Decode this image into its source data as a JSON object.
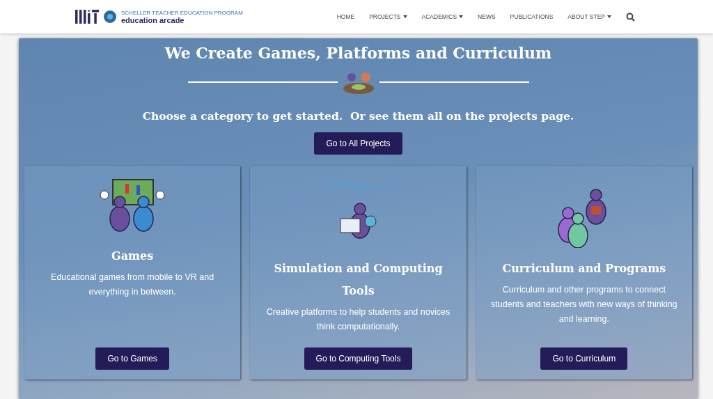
{
  "header": {
    "logo": {
      "program": "SCHELLER TEACHER EDUCATION PROGRAM",
      "name": "education arcade"
    },
    "nav": [
      {
        "label": "HOME",
        "dropdown": false
      },
      {
        "label": "PROJECTS",
        "dropdown": true
      },
      {
        "label": "ACADEMICS",
        "dropdown": true
      },
      {
        "label": "NEWS",
        "dropdown": false
      },
      {
        "label": "PUBLICATIONS",
        "dropdown": false
      },
      {
        "label": "ABOUT STEP",
        "dropdown": true
      }
    ]
  },
  "hero": {
    "title": "We Create Games, Platforms and Curriculum",
    "subtitle": "Choose a category to get started.  Or see them all on the projects page.",
    "button": "Go to All Projects"
  },
  "cards": [
    {
      "kind": "games",
      "title": "Games",
      "description": "Educational games from mobile to VR and everything in between.",
      "button": "Go to Games"
    },
    {
      "kind": "computing",
      "title": "Simulation and Computing Tools",
      "description": "Creative platforms to help students and novices think computationally.",
      "button": "Go to Computing Tools"
    },
    {
      "kind": "curriculum",
      "title": "Curriculum and Programs",
      "description": "Curriculum and other programs to connect students and teachers with new ways of thinking and learning.",
      "button": "Go to Curriculum"
    }
  ]
}
